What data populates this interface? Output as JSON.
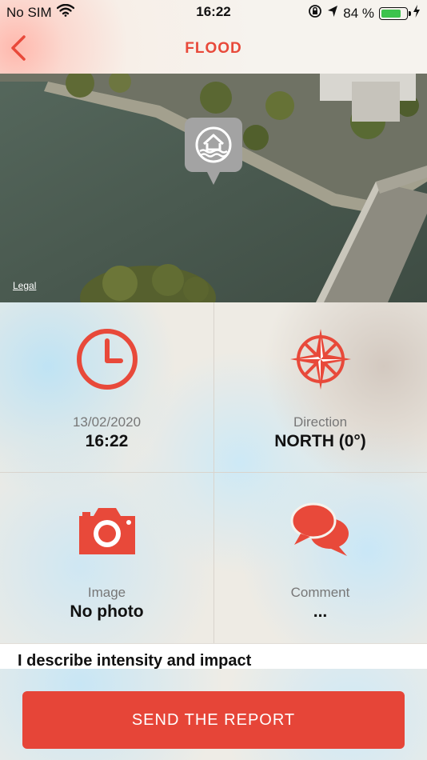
{
  "status_bar": {
    "carrier": "No SIM",
    "time": "16:22",
    "battery_percent": "84 %",
    "battery_level": 0.84,
    "icons": [
      "wifi-icon",
      "rotation-lock-icon",
      "location-arrow-icon",
      "battery-icon",
      "charging-bolt-icon"
    ]
  },
  "header": {
    "title": "FLOOD",
    "back_icon": "chevron-left-icon",
    "accent": "#e8493a"
  },
  "map": {
    "legal_label": "Legal",
    "pin_icon": "flood-house-icon"
  },
  "tiles": [
    {
      "icon": "clock-icon",
      "label": "13/02/2020",
      "value": "16:22"
    },
    {
      "icon": "compass-rose-icon",
      "label": "Direction",
      "value": "NORTH (0°)"
    },
    {
      "icon": "camera-icon",
      "label": "Image",
      "value": "No photo"
    },
    {
      "icon": "speech-bubbles-icon",
      "label": "Comment",
      "value": "..."
    }
  ],
  "describe": {
    "text": "I describe intensity and impact"
  },
  "send_button": {
    "label": "SEND THE REPORT",
    "color": "#e64538"
  }
}
